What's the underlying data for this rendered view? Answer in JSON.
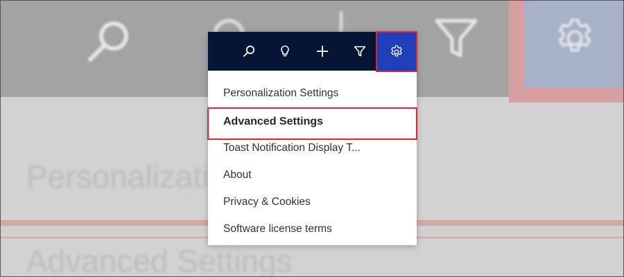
{
  "toolbar": {
    "buttons": [
      {
        "icon": "search-icon"
      },
      {
        "icon": "lightbulb-icon"
      },
      {
        "icon": "plus-icon"
      },
      {
        "icon": "filter-icon"
      },
      {
        "icon": "gear-icon",
        "active": true
      }
    ],
    "background": "#061436",
    "active_background": "#1f3fbd"
  },
  "menu": {
    "items": [
      {
        "label": "Personalization Settings"
      },
      {
        "label": "Advanced Settings"
      },
      {
        "label": "Toast Notification Display T..."
      },
      {
        "label": "About"
      },
      {
        "label": "Privacy & Cookies"
      },
      {
        "label": "Software license terms"
      }
    ]
  },
  "background_page": {
    "text_1": "Personalizatio",
    "text_2": "Advanced Settings"
  },
  "highlight_color": "#e5222d"
}
